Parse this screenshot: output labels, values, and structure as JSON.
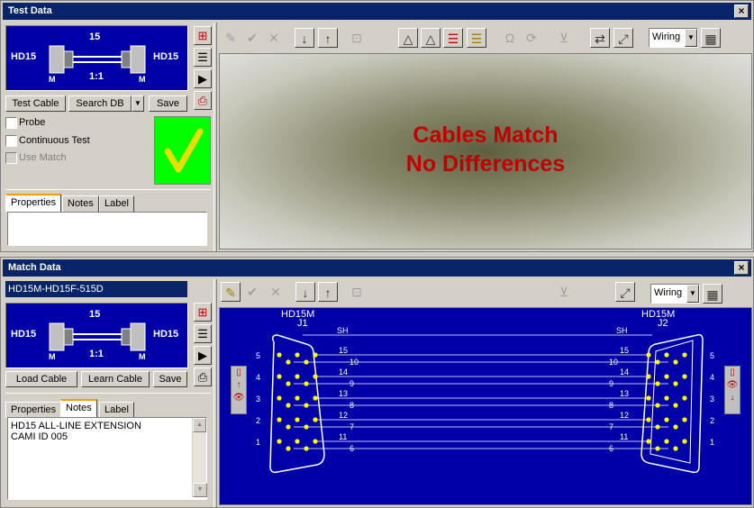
{
  "test": {
    "title": "Test Data",
    "cable": {
      "pins": "15",
      "left": "HD15",
      "right": "HD15",
      "ratio": "1:1",
      "left_gender": "M",
      "right_gender": "M"
    },
    "buttons": {
      "test_cable": "Test Cable",
      "search_db": "Search DB",
      "save": "Save"
    },
    "options": {
      "probe": "Probe",
      "continuous": "Continuous Test",
      "use_match": "Use Match"
    },
    "tabs": [
      "Properties",
      "Notes",
      "Label"
    ],
    "wiring_select": "Wiring",
    "result_line1": "Cables Match",
    "result_line2": "No Differences"
  },
  "match": {
    "title": "Match Data",
    "cable_name": "HD15M-HD15F-515D",
    "cable": {
      "pins": "15",
      "left": "HD15",
      "right": "HD15",
      "ratio": "1:1",
      "left_gender": "M",
      "right_gender": "M"
    },
    "buttons": {
      "load_cable": "Load Cable",
      "learn_cable": "Learn Cable",
      "save": "Save"
    },
    "tabs": [
      "Properties",
      "Notes",
      "Label"
    ],
    "notes_line1": "HD15 ALL-LINE EXTENSION",
    "notes_line2": "CAMI ID 005",
    "wiring_select": "Wiring",
    "diagram": {
      "j1_type": "HD15M",
      "j1_name": "J1",
      "j2_type": "HD15M",
      "j2_name": "J2",
      "shield": "SH",
      "row_labels": [
        "5",
        "4",
        "3",
        "2",
        "1"
      ],
      "wires_upper": [
        "15",
        "14",
        "13",
        "12",
        "11"
      ],
      "wires_lower": [
        "10",
        "9",
        "8",
        "7",
        "6"
      ]
    }
  },
  "colors": {
    "title_bg": "#0a246a",
    "diagram_bg": "#0000a8",
    "pin": "#ffff00",
    "result_text": "#c00000",
    "match_ok": "#00ff00"
  }
}
